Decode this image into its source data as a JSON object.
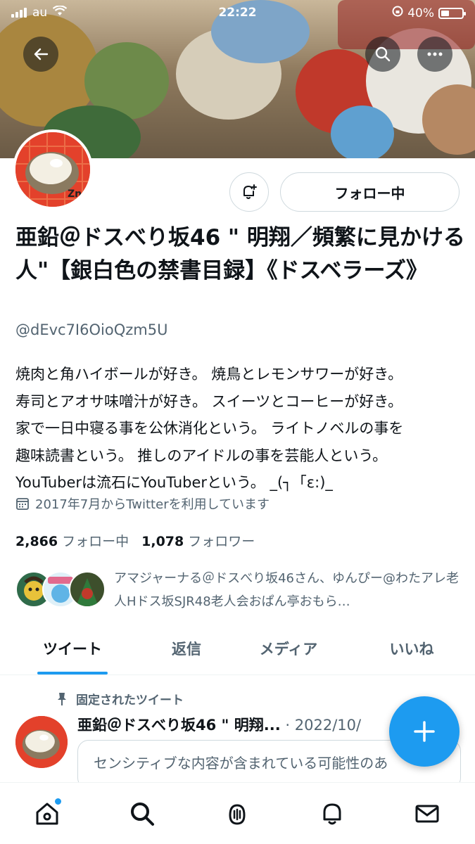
{
  "status_bar": {
    "carrier": "au",
    "time": "22:22",
    "battery": "40%",
    "battery_level": 0.4
  },
  "profile": {
    "name": "亜鉛＠ドスべり坂46 \" 明翔／頻繁に見かける人\"【銀白色の禁書目録】《ドスベラーズ》",
    "handle": "@dEvc7I6OioQzm5U",
    "bio": "焼肉と角ハイボールが好き。 焼鳥とレモンサワーが好き。\n寿司とアオサ味噌汁が好き。 スイーツとコーヒーが好き。\n家で一日中寝る事を公休消化という。 ライトノベルの事を\n趣味読書という。 推しのアイドルの事を芸能人という。\nYouTuberは流石にYouTuberという。 _(┐「ε:)_",
    "joined": "2017年7月からTwitterを利用しています",
    "following_count": "2,866",
    "following_label": "フォロー中",
    "followers_count": "1,078",
    "followers_label": "フォロワー",
    "follow_button_label": "フォロー中",
    "followers_you_know": "アマジャーナる＠ドスべり坂46さん、ゆんぴー@わたアレ老人Hドス坂SJR48老人会おぱん亭おもら…"
  },
  "tabs": [
    {
      "label": "ツイート",
      "active": true
    },
    {
      "label": "返信",
      "active": false
    },
    {
      "label": "メディア",
      "active": false
    },
    {
      "label": "いいね",
      "active": false
    }
  ],
  "pinned_tweet": {
    "pinned_label": "固定されたツイート",
    "author": "亜鉛＠ドスべり坂46 \" 明翔...",
    "meta": "· 2022/10/",
    "sensitive_notice": "センシティブな内容が含まれている可能性のあ"
  },
  "icons": {
    "back": "back-arrow-icon",
    "search": "search-icon",
    "more": "more-icon",
    "notify": "notification-bell-icon",
    "calendar": "calendar-icon",
    "pin": "pin-icon",
    "compose": "compose-plus-icon",
    "home": "home-icon",
    "explore": "search-icon",
    "spaces": "spaces-mic-icon",
    "notifications": "bell-icon",
    "messages": "mail-icon"
  },
  "colors": {
    "accent": "#1d9bf0",
    "text": "#0f1419",
    "secondary": "#536471",
    "border": "#cfd9de"
  }
}
